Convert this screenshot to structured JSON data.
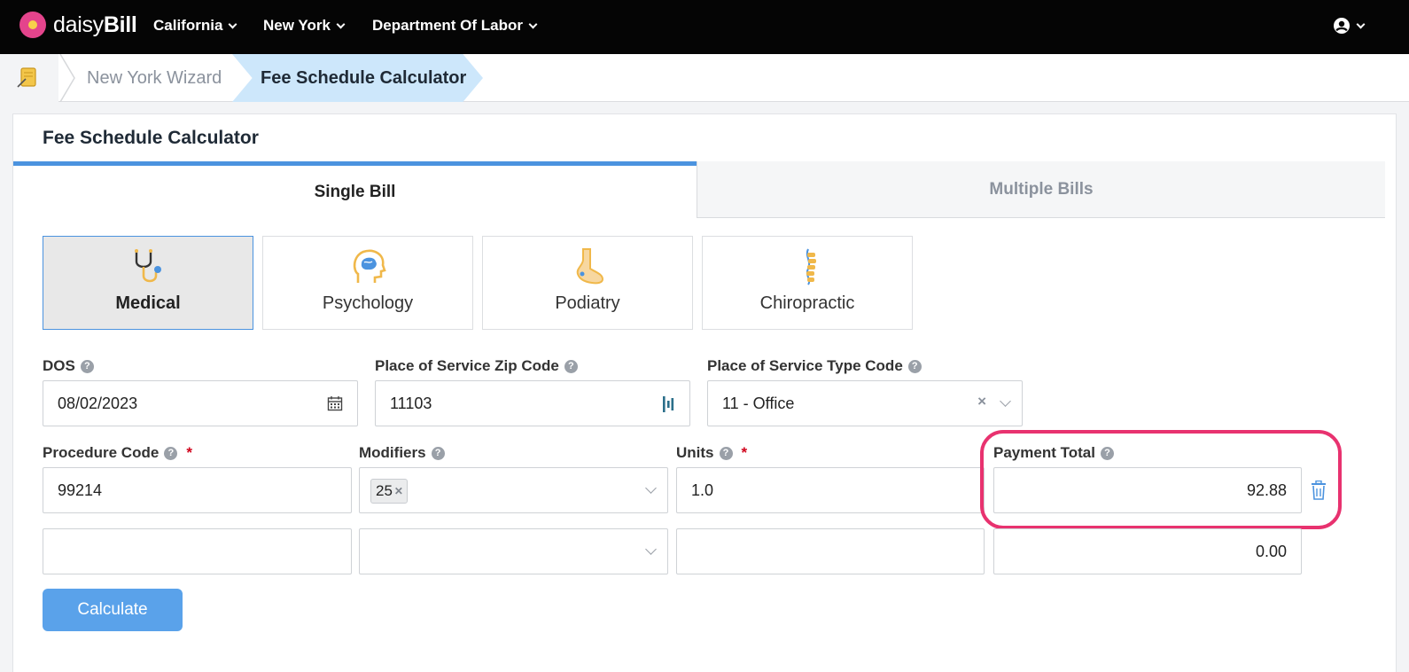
{
  "brand": {
    "name_light": "daisy",
    "name_bold": "Bill"
  },
  "nav": {
    "items": [
      "California",
      "New York",
      "Department Of Labor"
    ]
  },
  "breadcrumb": {
    "items": [
      "New York Wizard",
      "Fee Schedule Calculator"
    ]
  },
  "card": {
    "title": "Fee Schedule Calculator"
  },
  "tabs": {
    "single": "Single Bill",
    "multiple": "Multiple Bills",
    "active": "Single Bill"
  },
  "provider_types": [
    {
      "label": "Medical",
      "icon": "stethoscope-icon",
      "active": true
    },
    {
      "label": "Psychology",
      "icon": "brain-icon",
      "active": false
    },
    {
      "label": "Podiatry",
      "icon": "foot-icon",
      "active": false
    },
    {
      "label": "Chiropractic",
      "icon": "spine-icon",
      "active": false
    }
  ],
  "fields": {
    "dos": {
      "label": "DOS",
      "value": "08/02/2023"
    },
    "zip": {
      "label": "Place of Service Zip Code",
      "value": "11103"
    },
    "pos_type": {
      "label": "Place of Service Type Code",
      "value": "11 - Office"
    },
    "procedure_code": {
      "label": "Procedure Code",
      "required": "*"
    },
    "modifiers": {
      "label": "Modifiers"
    },
    "units": {
      "label": "Units",
      "required": "*"
    },
    "payment_total": {
      "label": "Payment Total"
    }
  },
  "lines": [
    {
      "procedure_code": "99214",
      "modifier_tag": "25",
      "units": "1.0",
      "payment_total": "92.88"
    },
    {
      "procedure_code": "",
      "modifier_tag": "",
      "units": "",
      "payment_total": "0.00"
    }
  ],
  "help_glyph": "?",
  "calculate_button": "Calculate",
  "colors": {
    "accent": "#4b93df",
    "button": "#5aa2ea",
    "highlight": "#e8326f",
    "required": "#d0021b"
  }
}
